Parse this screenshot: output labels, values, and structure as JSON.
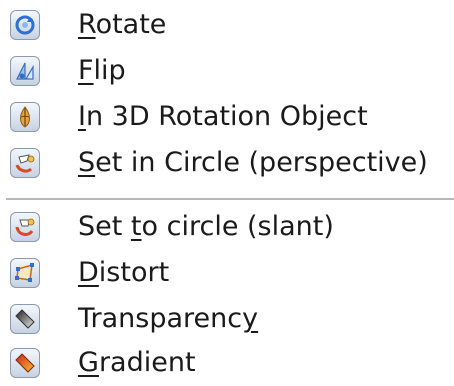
{
  "menu": {
    "items": [
      {
        "pre": "",
        "mn": "R",
        "post": "otate",
        "icon": "rotate-icon"
      },
      {
        "pre": "",
        "mn": "F",
        "post": "lip",
        "icon": "flip-icon"
      },
      {
        "pre": "",
        "mn": "I",
        "post": "n 3D Rotation Object",
        "icon": "3d-rotation-icon"
      },
      {
        "pre": "",
        "mn": "S",
        "post": "et in Circle (perspective)",
        "icon": "circle-perspective-icon"
      },
      {
        "pre": "Set ",
        "mn": "t",
        "post": "o circle (slant)",
        "icon": "circle-slant-icon"
      },
      {
        "pre": "",
        "mn": "D",
        "post": "istort",
        "icon": "distort-icon"
      },
      {
        "pre": "Transparenc",
        "mn": "y",
        "post": "",
        "icon": "transparency-icon"
      },
      {
        "pre": "",
        "mn": "G",
        "post": "radient",
        "icon": "gradient-icon"
      }
    ]
  }
}
